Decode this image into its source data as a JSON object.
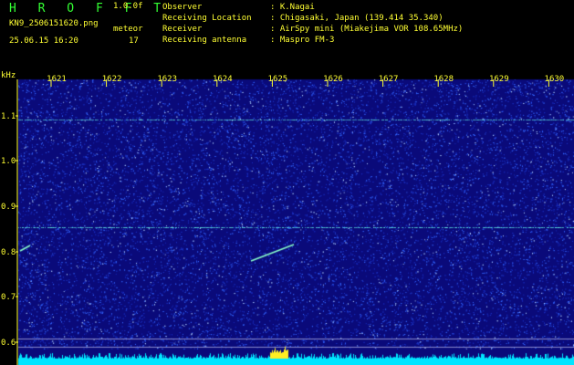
{
  "header": {
    "app_title": "H R O F F T",
    "version": "1.0.0f",
    "filename": "KN9_2506151620.png",
    "meteor_label": "meteor",
    "datetime": "25.06.15 16:20",
    "meteor_count": "17"
  },
  "info": [
    {
      "key": "Observer",
      "value": ": K.Nagai"
    },
    {
      "key": "Receiving Location",
      "value": ": Chigasaki, Japan (139.414 35.340)"
    },
    {
      "key": "Receiver",
      "value": ": AirSpy mini (Miakejima VOR 108.65MHz)"
    },
    {
      "key": "Receiving antenna",
      "value": ": Maspro FM-3"
    }
  ],
  "spectrogram": {
    "unit": "kHz",
    "x_ticks": [
      "1621",
      "1622",
      "1623",
      "1624",
      "1625",
      "1626",
      "1627",
      "1628",
      "1629",
      "1630"
    ],
    "y_ticks": [
      "1.1",
      "1.0",
      "0.9",
      "0.8",
      "0.7",
      "0.6"
    ],
    "background_color": "#0a0a7a",
    "noise_color": "#3366ff",
    "carrier_color": "#66ffee",
    "meteor_color": "#88ffcc",
    "label_color": "#ffff33",
    "band_color": "#00e5ff"
  }
}
